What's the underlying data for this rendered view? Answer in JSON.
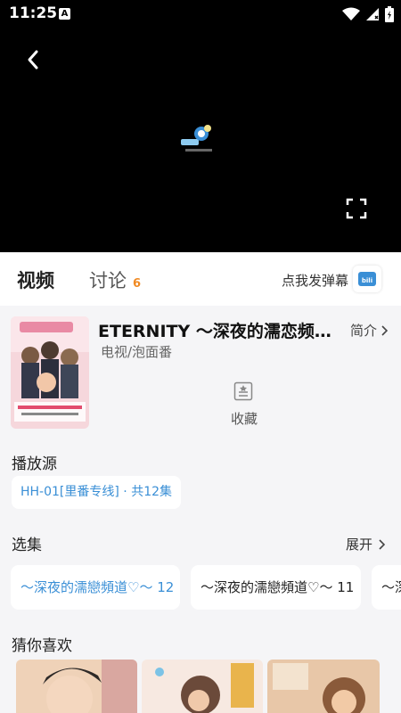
{
  "status_bar": {
    "time": "11:25",
    "notif_letter": "A"
  },
  "tabs": {
    "video": "视频",
    "discuss": "讨论",
    "discuss_count": "6",
    "danmaku": "点我发弹幕"
  },
  "anime": {
    "title": "ETERNITY ～深夜的濡恋频道～",
    "genre": "电视/泡面番",
    "intro_label": "简介",
    "favorite_label": "收藏"
  },
  "sources": {
    "heading": "播放源",
    "items": [
      "HH-01[里番专线] · 共12集"
    ]
  },
  "episodes": {
    "heading": "选集",
    "expand_label": "展开",
    "items": [
      "～深夜的濡戀頻道♡～ 12",
      "～深夜的濡戀頻道♡～ 11",
      "～深"
    ]
  },
  "recommend": {
    "heading": "猜你喜欢"
  },
  "colors": {
    "accent": "#3a8fd6",
    "badge": "#f08a24",
    "background": "#f5f5f7"
  }
}
